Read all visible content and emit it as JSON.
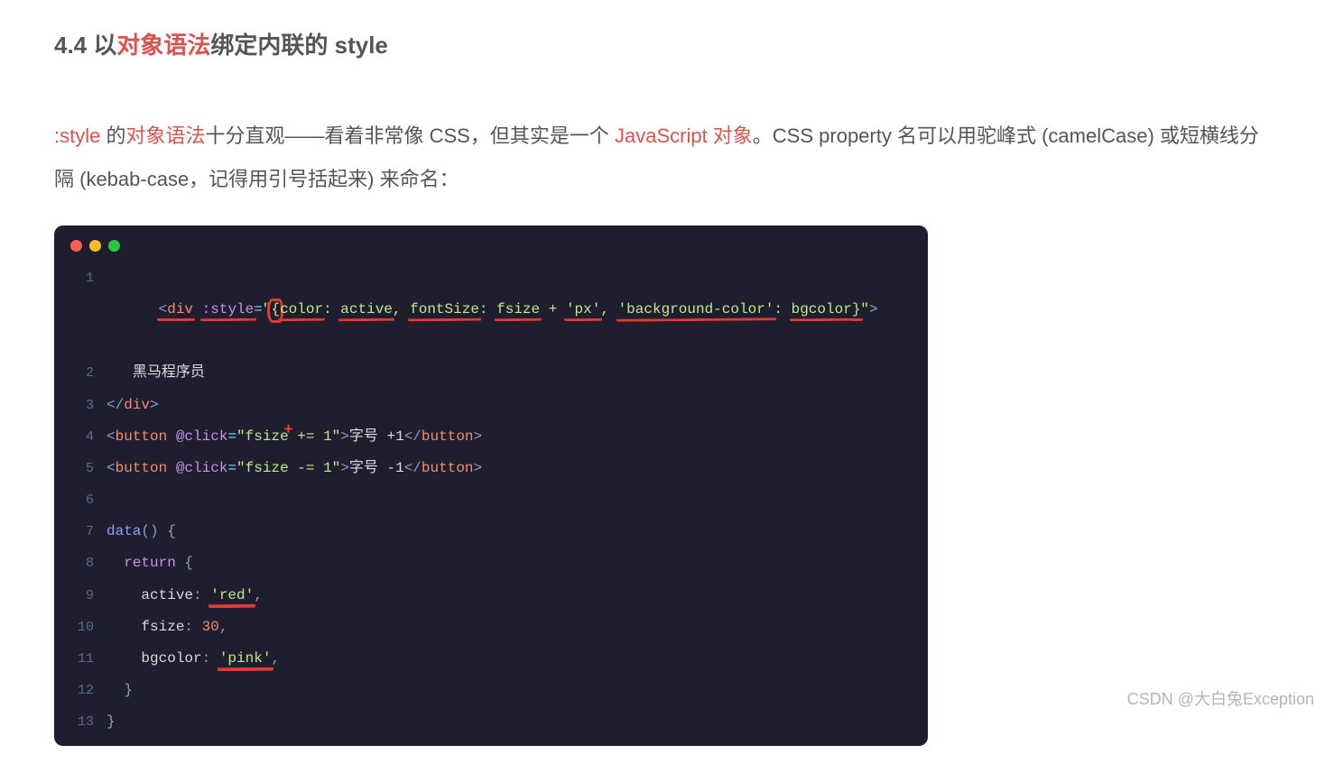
{
  "heading": {
    "prefix": "4.4 以",
    "highlight": "对象语法",
    "suffix": "绑定内联的 style"
  },
  "paragraph": {
    "seg1": ":style",
    "seg2": " 的",
    "hl1": "对象语法",
    "seg3": "十分直观——看着非常像 CSS，但其实是一个 ",
    "hl2": "JavaScript 对象",
    "seg4": "。CSS property 名可以用驼峰式 (camelCase) 或短横线分隔 (kebab-case，记得用引号括起来) 来命名："
  },
  "traffic": {
    "red": "close",
    "yellow": "minimize",
    "green": "zoom"
  },
  "code": {
    "lines": [
      "1",
      "2",
      "3",
      "4",
      "5",
      "6",
      "7",
      "8",
      "9",
      "10",
      "11",
      "12",
      "13"
    ],
    "l1": {
      "open": "<",
      "tag": "div",
      "sp": " ",
      "attr": ":style",
      "eq": "=",
      "q": "\"",
      "brace_open": "{",
      "k1": "color",
      "c1": ": ",
      "v1": "active",
      "comma1": ", ",
      "k2": "fontSize",
      "c2": ": ",
      "v2": "fsize",
      "plus": " + ",
      "px": "'px'",
      "comma2": ", ",
      "k3": "'background-color'",
      "c3": ": ",
      "v3": "bgcolor",
      "brace_close": "}",
      "q2": "\"",
      "close": ">"
    },
    "l2": {
      "txt": "黑马程序员"
    },
    "l3": {
      "open": "</",
      "tag": "div",
      "close": ">"
    },
    "l4": {
      "open": "<",
      "tag": "button",
      "sp": " ",
      "attr": "@click",
      "eq": "=",
      "q": "\"",
      "expr": "fsize += 1",
      "q2": "\"",
      "close": ">",
      "txt": "字号 +1",
      "open2": "</",
      "tag2": "button",
      "close2": ">"
    },
    "l5": {
      "open": "<",
      "tag": "button",
      "sp": " ",
      "attr": "@click",
      "eq": "=",
      "q": "\"",
      "expr": "fsize -= 1",
      "q2": "\"",
      "close": ">",
      "txt": "字号 -1",
      "open2": "</",
      "tag2": "button",
      "close2": ">"
    },
    "l7": {
      "fn": "data",
      "paren": "()",
      "sp": " ",
      "brace": "{"
    },
    "l8": {
      "indent": "  ",
      "kw": "return",
      "sp": " ",
      "brace": "{"
    },
    "l9": {
      "indent": "    ",
      "key": "active",
      "colon": ": ",
      "val": "'red'",
      "comma": ","
    },
    "l10": {
      "indent": "    ",
      "key": "fsize",
      "colon": ": ",
      "val": "30",
      "comma": ","
    },
    "l11": {
      "indent": "    ",
      "key": "bgcolor",
      "colon": ": ",
      "val": "'pink'",
      "comma": ","
    },
    "l12": {
      "indent": "  ",
      "brace": "}"
    },
    "l13": {
      "brace": "}"
    }
  },
  "watermark": "CSDN @大白兔Exception"
}
